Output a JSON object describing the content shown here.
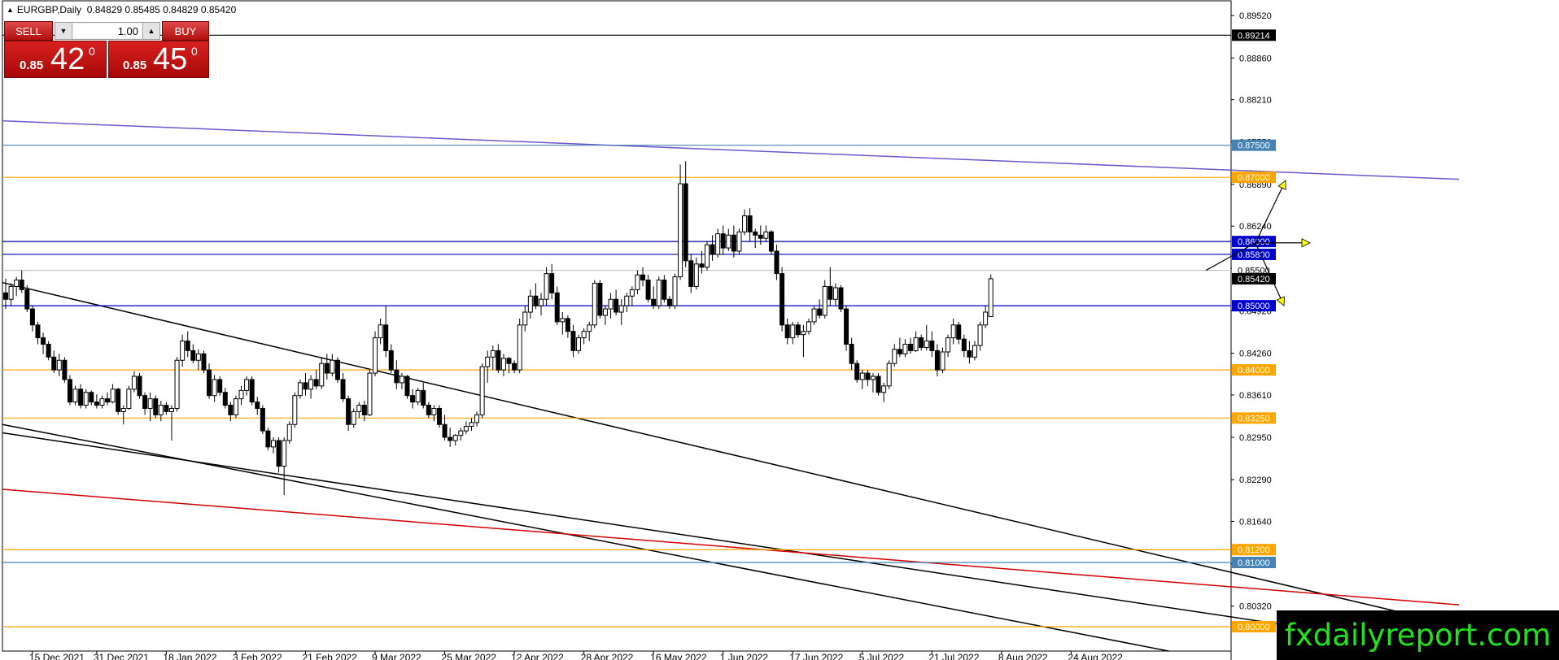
{
  "header": {
    "symbol": "EURGBP,Daily",
    "ohlc": "0.84829 0.85485 0.84829 0.85420"
  },
  "trade_panel": {
    "sell_label": "SELL",
    "buy_label": "BUY",
    "lot_value": "1.00",
    "bid_prefix": "0.85",
    "bid_big": "42",
    "bid_sup": "0",
    "ask_prefix": "0.85",
    "ask_big": "45",
    "ask_sup": "0"
  },
  "watermark": "fxdailyreport.com",
  "chart_data": {
    "type": "candlestick",
    "symbol": "EURGBP",
    "timeframe": "Daily",
    "ylim": [
      0.7962,
      0.8975
    ],
    "grid": false,
    "price_ticks": [
      "0.89520",
      "0.88860",
      "0.88210",
      "0.87550",
      "0.86890",
      "0.86240",
      "0.85580",
      "0.84920",
      "0.84260",
      "0.83610",
      "0.82950",
      "0.82290",
      "0.81640",
      "0.80980",
      "0.80320"
    ],
    "date_ticks": [
      "15 Dec 2021",
      "31 Dec 2021",
      "18 Jan 2022",
      "3 Feb 2022",
      "21 Feb 2022",
      "9 Mar 2022",
      "25 Mar 2022",
      "12 Apr 2022",
      "28 Apr 2022",
      "16 May 2022",
      "1 Jun 2022",
      "17 Jun 2022",
      "5 Jul 2022",
      "21 Jul 2022",
      "8 Aug 2022",
      "24 Aug 2022"
    ],
    "horizontal_levels": [
      {
        "label": "0.89214",
        "price": 0.89214,
        "line_color": "#000000",
        "label_bg": "#000000"
      },
      {
        "label": "0.87500",
        "price": 0.875,
        "line_color": "#4682b4",
        "label_bg": "#4682b4"
      },
      {
        "label": "0.87000",
        "price": 0.87,
        "line_color": "#ffa500",
        "label_bg": "#ffa500"
      },
      {
        "label": "0.86000",
        "price": 0.86,
        "line_color": "#0000aa",
        "label_bg": "#0000cd"
      },
      {
        "label": "0.85800",
        "price": 0.858,
        "line_color": "#0000aa",
        "label_bg": "#0000cd"
      },
      {
        "label": "0.85500",
        "price": 0.8555,
        "line_color": "#c0c0c0",
        "label_bg": "#ffffff",
        "label_text_color": "#000000"
      },
      {
        "label": "0.85000",
        "price": 0.85,
        "line_color": "#0000cd",
        "label_bg": "#0000cd"
      },
      {
        "label": "0.84000",
        "price": 0.84,
        "line_color": "#ffa500",
        "label_bg": "#ffa500"
      },
      {
        "label": "0.83250",
        "price": 0.8325,
        "line_color": "#ffa500",
        "label_bg": "#ffa500"
      },
      {
        "label": "0.81200",
        "price": 0.812,
        "line_color": "#ffa500",
        "label_bg": "#ffa500"
      },
      {
        "label": "0.81000",
        "price": 0.81,
        "line_color": "#4682b4",
        "label_bg": "#4682b4"
      },
      {
        "label": "0.80000",
        "price": 0.8,
        "line_color": "#ffa500",
        "label_bg": "#ffa500"
      }
    ],
    "current_price": {
      "label": "0.85420",
      "price": 0.8542
    },
    "trendlines": [
      {
        "color": "#6a5acd",
        "from": [
          "2021-12-06",
          0.8788
        ],
        "to": [
          "2022-09-13",
          0.8697
        ]
      },
      {
        "color": "#000000",
        "from": [
          "2021-12-06",
          0.8536
        ],
        "to": [
          "2022-09-13",
          0.8001
        ]
      },
      {
        "color": "#000000",
        "from": [
          "2021-12-06",
          0.8315
        ],
        "to": [
          "2022-07-19",
          0.7962
        ]
      },
      {
        "color": "#000000",
        "from": [
          "2021-12-06",
          0.8302
        ],
        "to": [
          "2022-09-13",
          0.7962
        ]
      },
      {
        "color": "#d40000",
        "from": [
          "2021-12-06",
          0.8214
        ],
        "to": [
          "2022-09-13",
          0.8034
        ]
      }
    ],
    "scenario_arrows": [
      {
        "direction": "up",
        "color": "#ffff00"
      },
      {
        "direction": "sideways",
        "color": "#ffff00"
      },
      {
        "direction": "down",
        "color": "#ffff00"
      }
    ],
    "candles_ohlc": [
      [
        0.852,
        0.8542,
        0.8495,
        0.851
      ],
      [
        0.851,
        0.8535,
        0.85,
        0.853
      ],
      [
        0.853,
        0.8545,
        0.8515,
        0.854
      ],
      [
        0.854,
        0.8555,
        0.852,
        0.8525
      ],
      [
        0.8525,
        0.8532,
        0.849,
        0.8495
      ],
      [
        0.8495,
        0.85,
        0.846,
        0.847
      ],
      [
        0.847,
        0.8475,
        0.844,
        0.845
      ],
      [
        0.845,
        0.8458,
        0.8425,
        0.844
      ],
      [
        0.844,
        0.8445,
        0.8415,
        0.842
      ],
      [
        0.842,
        0.843,
        0.8395,
        0.84
      ],
      [
        0.84,
        0.8425,
        0.839,
        0.8415
      ],
      [
        0.8415,
        0.842,
        0.838,
        0.8385
      ],
      [
        0.8385,
        0.8392,
        0.8345,
        0.835
      ],
      [
        0.835,
        0.8375,
        0.8345,
        0.837
      ],
      [
        0.837,
        0.8378,
        0.834,
        0.8345
      ],
      [
        0.8345,
        0.837,
        0.834,
        0.8365
      ],
      [
        0.8365,
        0.8368,
        0.8345,
        0.835
      ],
      [
        0.835,
        0.8362,
        0.834,
        0.8345
      ],
      [
        0.8345,
        0.836,
        0.834,
        0.8355
      ],
      [
        0.8355,
        0.8365,
        0.8345,
        0.835
      ],
      [
        0.835,
        0.8378,
        0.8348,
        0.837
      ],
      [
        0.837,
        0.8372,
        0.833,
        0.8335
      ],
      [
        0.8335,
        0.8345,
        0.8315,
        0.834
      ],
      [
        0.834,
        0.8375,
        0.8338,
        0.837
      ],
      [
        0.837,
        0.8398,
        0.8365,
        0.839
      ],
      [
        0.839,
        0.8395,
        0.8355,
        0.836
      ],
      [
        0.836,
        0.8365,
        0.833,
        0.834
      ],
      [
        0.834,
        0.8365,
        0.832,
        0.8355
      ],
      [
        0.8355,
        0.836,
        0.8325,
        0.833
      ],
      [
        0.833,
        0.8352,
        0.832,
        0.8345
      ],
      [
        0.8345,
        0.835,
        0.833,
        0.8335
      ],
      [
        0.8335,
        0.8345,
        0.829,
        0.834
      ],
      [
        0.834,
        0.842,
        0.8335,
        0.8415
      ],
      [
        0.8415,
        0.8455,
        0.8405,
        0.8445
      ],
      [
        0.8445,
        0.846,
        0.842,
        0.843
      ],
      [
        0.843,
        0.844,
        0.841,
        0.8415
      ],
      [
        0.8415,
        0.8432,
        0.84,
        0.8425
      ],
      [
        0.8425,
        0.843,
        0.8395,
        0.84
      ],
      [
        0.84,
        0.841,
        0.8355,
        0.836
      ],
      [
        0.836,
        0.8392,
        0.835,
        0.8385
      ],
      [
        0.8385,
        0.839,
        0.836,
        0.8365
      ],
      [
        0.8365,
        0.8372,
        0.834,
        0.8345
      ],
      [
        0.8345,
        0.835,
        0.832,
        0.833
      ],
      [
        0.833,
        0.836,
        0.8325,
        0.8355
      ],
      [
        0.8355,
        0.8375,
        0.8345,
        0.8368
      ],
      [
        0.8368,
        0.839,
        0.836,
        0.8385
      ],
      [
        0.8385,
        0.839,
        0.8345,
        0.835
      ],
      [
        0.835,
        0.8358,
        0.833,
        0.834
      ],
      [
        0.834,
        0.8345,
        0.83,
        0.8305
      ],
      [
        0.8305,
        0.831,
        0.8275,
        0.828
      ],
      [
        0.828,
        0.8295,
        0.827,
        0.829
      ],
      [
        0.829,
        0.8295,
        0.824,
        0.825
      ],
      [
        0.825,
        0.8295,
        0.8205,
        0.829
      ],
      [
        0.829,
        0.832,
        0.8285,
        0.8315
      ],
      [
        0.8315,
        0.8365,
        0.831,
        0.836
      ],
      [
        0.836,
        0.8385,
        0.8355,
        0.838
      ],
      [
        0.838,
        0.8395,
        0.836,
        0.837
      ],
      [
        0.837,
        0.8392,
        0.8355,
        0.8385
      ],
      [
        0.8385,
        0.84,
        0.837,
        0.8375
      ],
      [
        0.8375,
        0.842,
        0.837,
        0.841
      ],
      [
        0.841,
        0.8425,
        0.8385,
        0.8395
      ],
      [
        0.8395,
        0.8425,
        0.839,
        0.8415
      ],
      [
        0.8415,
        0.842,
        0.838,
        0.8385
      ],
      [
        0.8385,
        0.8395,
        0.835,
        0.8355
      ],
      [
        0.8355,
        0.836,
        0.8305,
        0.8315
      ],
      [
        0.8315,
        0.834,
        0.831,
        0.8335
      ],
      [
        0.8335,
        0.835,
        0.8325,
        0.8345
      ],
      [
        0.8345,
        0.8352,
        0.832,
        0.833
      ],
      [
        0.833,
        0.84,
        0.8328,
        0.8395
      ],
      [
        0.8395,
        0.846,
        0.839,
        0.845
      ],
      [
        0.845,
        0.848,
        0.844,
        0.847
      ],
      [
        0.847,
        0.85,
        0.842,
        0.843
      ],
      [
        0.843,
        0.844,
        0.8395,
        0.84
      ],
      [
        0.84,
        0.8415,
        0.837,
        0.838
      ],
      [
        0.838,
        0.8395,
        0.837,
        0.839
      ],
      [
        0.839,
        0.8392,
        0.8355,
        0.836
      ],
      [
        0.836,
        0.837,
        0.834,
        0.835
      ],
      [
        0.835,
        0.8372,
        0.8345,
        0.8368
      ],
      [
        0.8368,
        0.838,
        0.834,
        0.8345
      ],
      [
        0.8345,
        0.835,
        0.8325,
        0.833
      ],
      [
        0.833,
        0.8345,
        0.832,
        0.834
      ],
      [
        0.834,
        0.8345,
        0.831,
        0.8315
      ],
      [
        0.8315,
        0.833,
        0.829,
        0.8295
      ],
      [
        0.8295,
        0.831,
        0.828,
        0.829
      ],
      [
        0.829,
        0.83,
        0.8282,
        0.8298
      ],
      [
        0.8298,
        0.831,
        0.829,
        0.8305
      ],
      [
        0.8305,
        0.832,
        0.83,
        0.8312
      ],
      [
        0.8312,
        0.8325,
        0.8305,
        0.8318
      ],
      [
        0.8318,
        0.8335,
        0.8312,
        0.833
      ],
      [
        0.833,
        0.841,
        0.8325,
        0.8405
      ],
      [
        0.8405,
        0.843,
        0.838,
        0.842
      ],
      [
        0.842,
        0.8438,
        0.84,
        0.843
      ],
      [
        0.843,
        0.844,
        0.8395,
        0.84
      ],
      [
        0.84,
        0.8425,
        0.839,
        0.8418
      ],
      [
        0.8418,
        0.842,
        0.8395,
        0.841
      ],
      [
        0.841,
        0.8415,
        0.8395,
        0.84
      ],
      [
        0.84,
        0.848,
        0.8395,
        0.847
      ],
      [
        0.847,
        0.85,
        0.846,
        0.849
      ],
      [
        0.849,
        0.8525,
        0.848,
        0.8515
      ],
      [
        0.8515,
        0.8535,
        0.8495,
        0.85
      ],
      [
        0.85,
        0.852,
        0.8485,
        0.851
      ],
      [
        0.851,
        0.856,
        0.85,
        0.855
      ],
      [
        0.855,
        0.8565,
        0.851,
        0.852
      ],
      [
        0.852,
        0.853,
        0.847,
        0.8475
      ],
      [
        0.8475,
        0.849,
        0.8455,
        0.848
      ],
      [
        0.848,
        0.8485,
        0.845,
        0.846
      ],
      [
        0.846,
        0.847,
        0.842,
        0.843
      ],
      [
        0.843,
        0.8455,
        0.8425,
        0.845
      ],
      [
        0.845,
        0.8465,
        0.844,
        0.846
      ],
      [
        0.846,
        0.8475,
        0.8445,
        0.847
      ],
      [
        0.847,
        0.854,
        0.8465,
        0.8535
      ],
      [
        0.8535,
        0.854,
        0.848,
        0.8485
      ],
      [
        0.8485,
        0.85,
        0.847,
        0.8495
      ],
      [
        0.8495,
        0.852,
        0.848,
        0.851
      ],
      [
        0.851,
        0.8525,
        0.8485,
        0.849
      ],
      [
        0.849,
        0.851,
        0.847,
        0.85
      ],
      [
        0.85,
        0.852,
        0.849,
        0.8515
      ],
      [
        0.8515,
        0.853,
        0.85,
        0.8525
      ],
      [
        0.8525,
        0.8555,
        0.8518,
        0.8548
      ],
      [
        0.8548,
        0.856,
        0.853,
        0.854
      ],
      [
        0.854,
        0.8548,
        0.8505,
        0.851
      ],
      [
        0.851,
        0.853,
        0.8495,
        0.85
      ],
      [
        0.85,
        0.8545,
        0.8495,
        0.854
      ],
      [
        0.854,
        0.8548,
        0.8505,
        0.851
      ],
      [
        0.851,
        0.8515,
        0.8495,
        0.85
      ],
      [
        0.85,
        0.855,
        0.8495,
        0.8545
      ],
      [
        0.8545,
        0.872,
        0.854,
        0.869
      ],
      [
        0.869,
        0.8725,
        0.856,
        0.857
      ],
      [
        0.857,
        0.858,
        0.852,
        0.853
      ],
      [
        0.853,
        0.8575,
        0.8525,
        0.8565
      ],
      [
        0.8565,
        0.8585,
        0.855,
        0.856
      ],
      [
        0.856,
        0.86,
        0.8555,
        0.8595
      ],
      [
        0.8595,
        0.861,
        0.857,
        0.858
      ],
      [
        0.858,
        0.862,
        0.8575,
        0.8612
      ],
      [
        0.8612,
        0.8625,
        0.858,
        0.859
      ],
      [
        0.859,
        0.862,
        0.8585,
        0.861
      ],
      [
        0.861,
        0.8625,
        0.8575,
        0.8585
      ],
      [
        0.8585,
        0.862,
        0.858,
        0.8615
      ],
      [
        0.8615,
        0.865,
        0.861,
        0.864
      ],
      [
        0.864,
        0.8652,
        0.86,
        0.8615
      ],
      [
        0.8615,
        0.862,
        0.859,
        0.861
      ],
      [
        0.861,
        0.8625,
        0.8595,
        0.8605
      ],
      [
        0.8605,
        0.8625,
        0.86,
        0.8615
      ],
      [
        0.8615,
        0.8618,
        0.858,
        0.8585
      ],
      [
        0.8585,
        0.8595,
        0.854,
        0.855
      ],
      [
        0.855,
        0.856,
        0.846,
        0.847
      ],
      [
        0.847,
        0.848,
        0.844,
        0.845
      ],
      [
        0.845,
        0.8475,
        0.844,
        0.847
      ],
      [
        0.847,
        0.8475,
        0.845,
        0.8455
      ],
      [
        0.8455,
        0.847,
        0.842,
        0.846
      ],
      [
        0.846,
        0.848,
        0.8455,
        0.8475
      ],
      [
        0.8475,
        0.85,
        0.847,
        0.8495
      ],
      [
        0.8495,
        0.851,
        0.848,
        0.8485
      ],
      [
        0.8485,
        0.854,
        0.848,
        0.853
      ],
      [
        0.853,
        0.856,
        0.85,
        0.851
      ],
      [
        0.851,
        0.8535,
        0.85,
        0.8528
      ],
      [
        0.8528,
        0.8532,
        0.849,
        0.8495
      ],
      [
        0.8495,
        0.85,
        0.843,
        0.844
      ],
      [
        0.844,
        0.845,
        0.84,
        0.841
      ],
      [
        0.841,
        0.8415,
        0.838,
        0.8385
      ],
      [
        0.8385,
        0.84,
        0.837,
        0.8395
      ],
      [
        0.8395,
        0.84,
        0.8375,
        0.8385
      ],
      [
        0.8385,
        0.8395,
        0.8365,
        0.839
      ],
      [
        0.839,
        0.8395,
        0.836,
        0.8365
      ],
      [
        0.8365,
        0.838,
        0.835,
        0.8375
      ],
      [
        0.8375,
        0.8415,
        0.837,
        0.841
      ],
      [
        0.841,
        0.844,
        0.8405,
        0.8432
      ],
      [
        0.8432,
        0.845,
        0.842,
        0.8425
      ],
      [
        0.8425,
        0.8448,
        0.842,
        0.844
      ],
      [
        0.844,
        0.845,
        0.8425,
        0.843
      ],
      [
        0.843,
        0.846,
        0.8428,
        0.845
      ],
      [
        0.845,
        0.8455,
        0.843,
        0.8435
      ],
      [
        0.8435,
        0.847,
        0.843,
        0.8445
      ],
      [
        0.8445,
        0.846,
        0.842,
        0.843
      ],
      [
        0.843,
        0.844,
        0.839,
        0.84
      ],
      [
        0.84,
        0.8435,
        0.8395,
        0.8428
      ],
      [
        0.8428,
        0.8455,
        0.842,
        0.845
      ],
      [
        0.845,
        0.848,
        0.844,
        0.847
      ],
      [
        0.847,
        0.8475,
        0.844,
        0.8448
      ],
      [
        0.8448,
        0.8455,
        0.842,
        0.843
      ],
      [
        0.843,
        0.8445,
        0.841,
        0.842
      ],
      [
        0.842,
        0.8445,
        0.8415,
        0.8438
      ],
      [
        0.8438,
        0.8475,
        0.843,
        0.847
      ],
      [
        0.847,
        0.85,
        0.8465,
        0.849
      ],
      [
        0.8483,
        0.8549,
        0.8483,
        0.8542
      ]
    ]
  }
}
